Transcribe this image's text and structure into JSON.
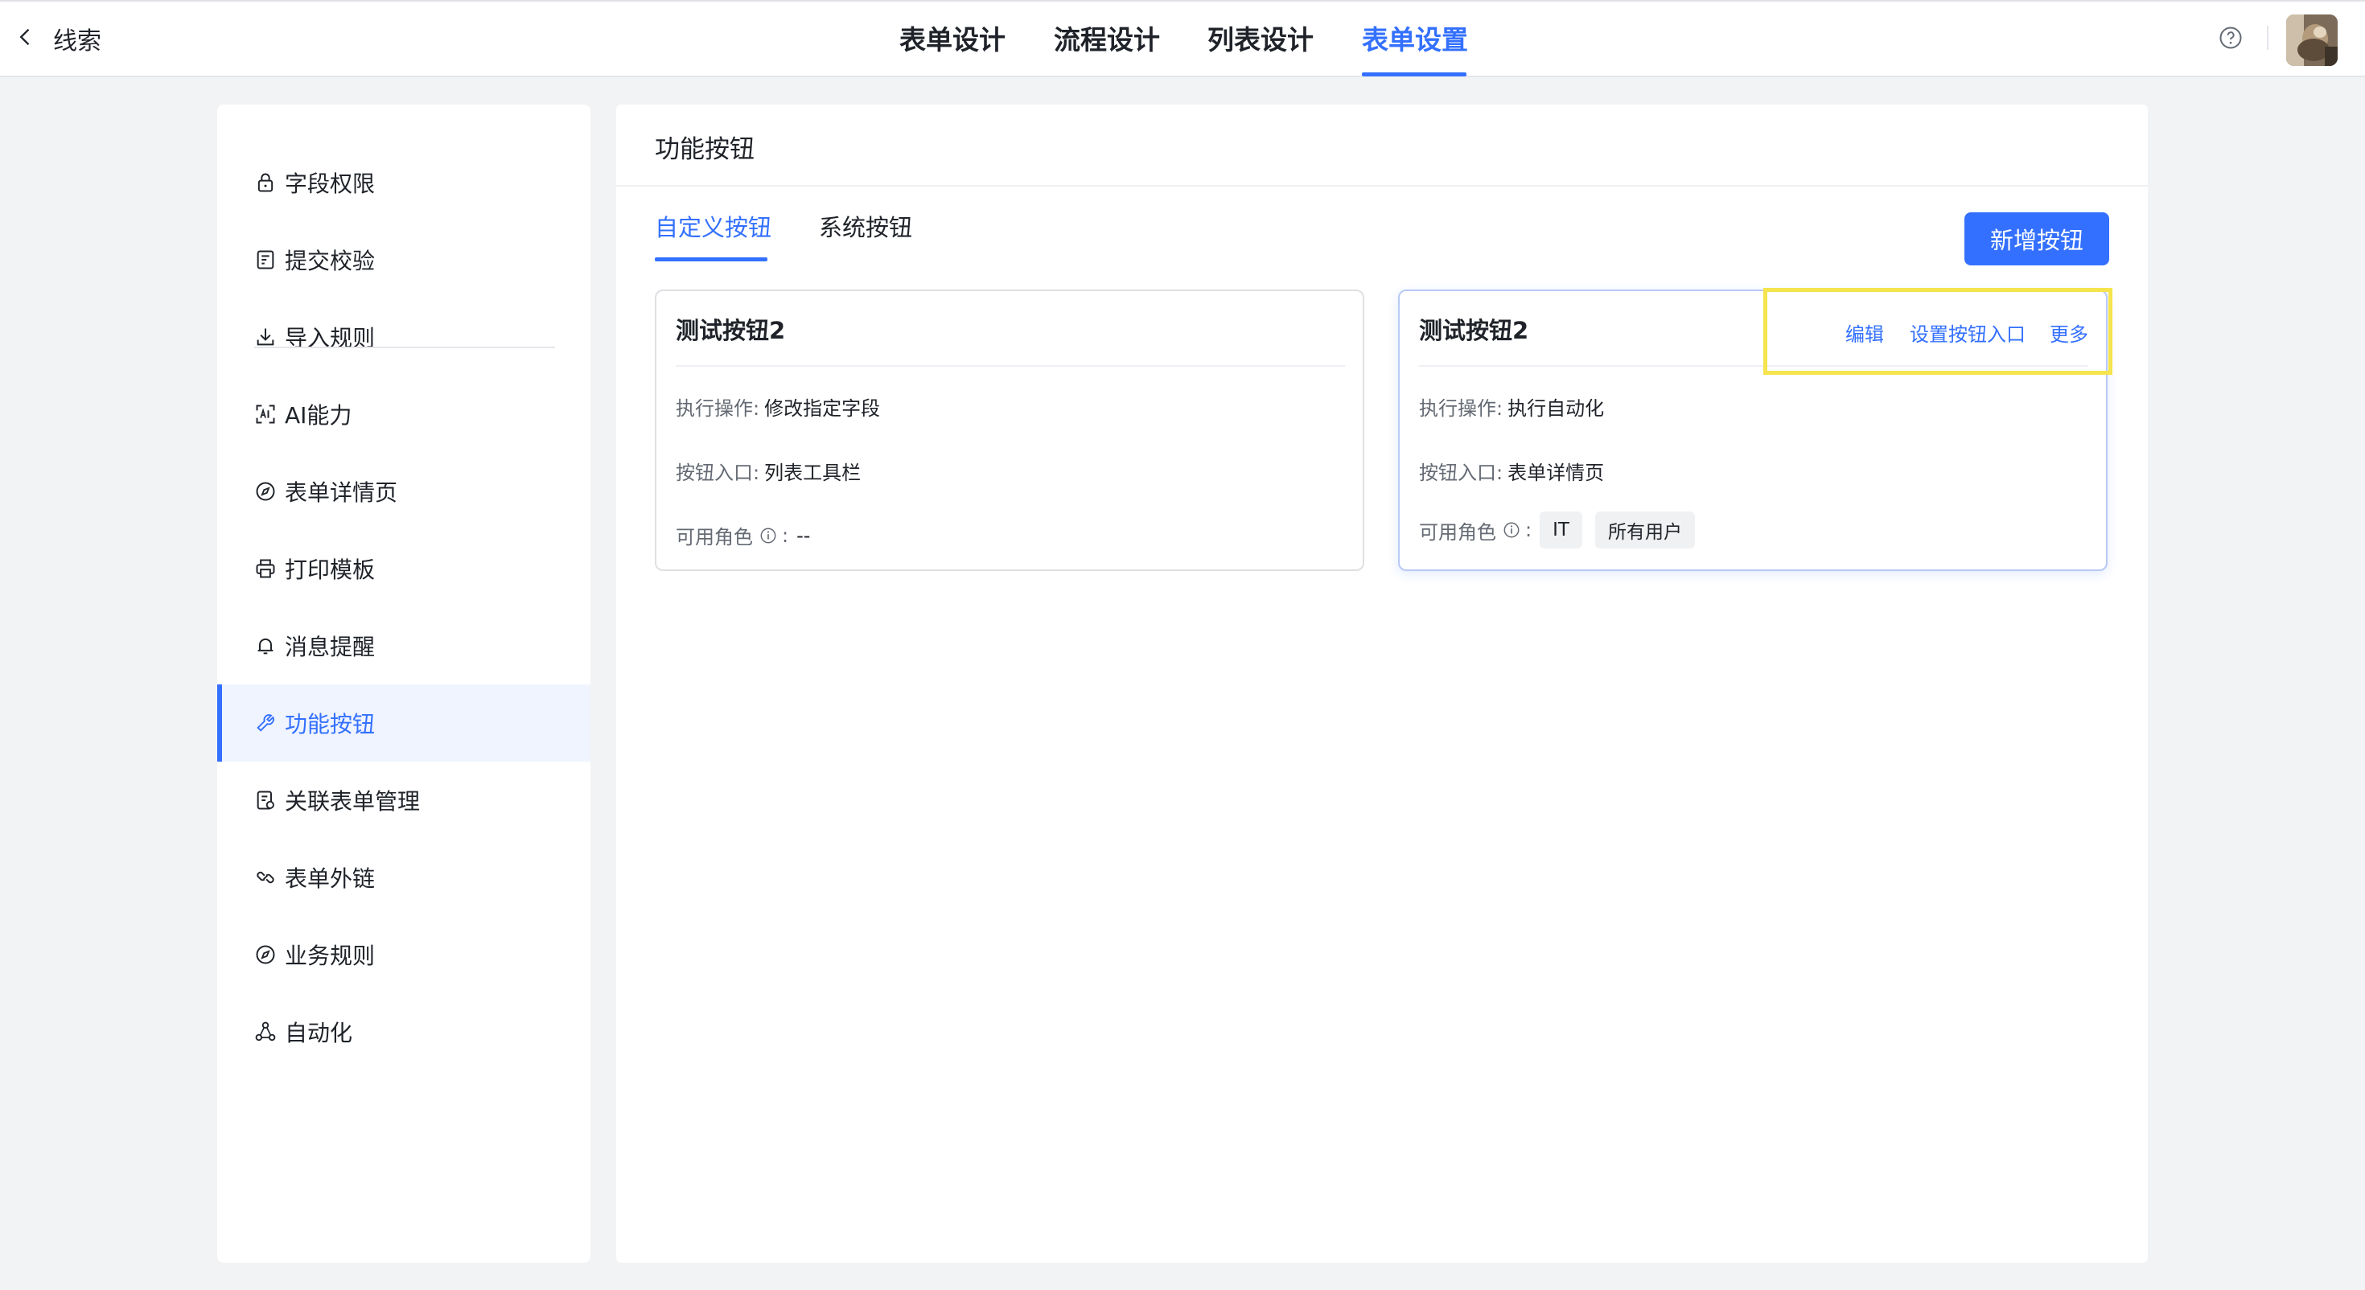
{
  "header": {
    "back_label": "线索",
    "tabs": [
      {
        "label": "表单设计"
      },
      {
        "label": "流程设计"
      },
      {
        "label": "列表设计"
      },
      {
        "label": "表单设置"
      }
    ],
    "active_tab": "表单设置"
  },
  "sidebar": {
    "items": [
      {
        "label": "字段权限",
        "icon": "lock-icon"
      },
      {
        "label": "提交校验",
        "icon": "form-check-icon"
      },
      {
        "label": "导入规则",
        "icon": "download-icon"
      },
      {
        "label": "AI能力",
        "icon": "ai-scan-icon"
      },
      {
        "label": "表单详情页",
        "icon": "compass-icon"
      },
      {
        "label": "打印模板",
        "icon": "printer-icon"
      },
      {
        "label": "消息提醒",
        "icon": "bell-icon"
      },
      {
        "label": "功能按钮",
        "icon": "wrench-icon"
      },
      {
        "label": "关联表单管理",
        "icon": "linked-form-icon"
      },
      {
        "label": "表单外链",
        "icon": "link-icon"
      },
      {
        "label": "业务规则",
        "icon": "compass-icon"
      },
      {
        "label": "自动化",
        "icon": "automation-icon"
      }
    ],
    "active_item": "功能按钮"
  },
  "main": {
    "title": "功能按钮",
    "tabs": [
      {
        "label": "自定义按钮"
      },
      {
        "label": "系统按钮"
      }
    ],
    "active_tab": "自定义按钮",
    "add_button_label": "新增按钮",
    "cards": [
      {
        "title": "测试按钮2",
        "action_label": "执行操作:",
        "action_value": "修改指定字段",
        "entry_label": "按钮入口:",
        "entry_value": "列表工具栏",
        "roles_label": "可用角色",
        "roles_colon": ":",
        "roles_value": "--"
      },
      {
        "title": "测试按钮2",
        "action_label": "执行操作:",
        "action_value": "执行自动化",
        "entry_label": "按钮入口:",
        "entry_value": "表单详情页",
        "roles_label": "可用角色",
        "roles_colon": ":",
        "roles": [
          "IT",
          "所有用户"
        ],
        "actions": {
          "edit": "编辑",
          "set_entry": "设置按钮入口",
          "more": "更多"
        }
      }
    ]
  },
  "colors": {
    "accent": "#3370ff",
    "highlight": "#f5e44e",
    "background": "#f2f3f5"
  }
}
